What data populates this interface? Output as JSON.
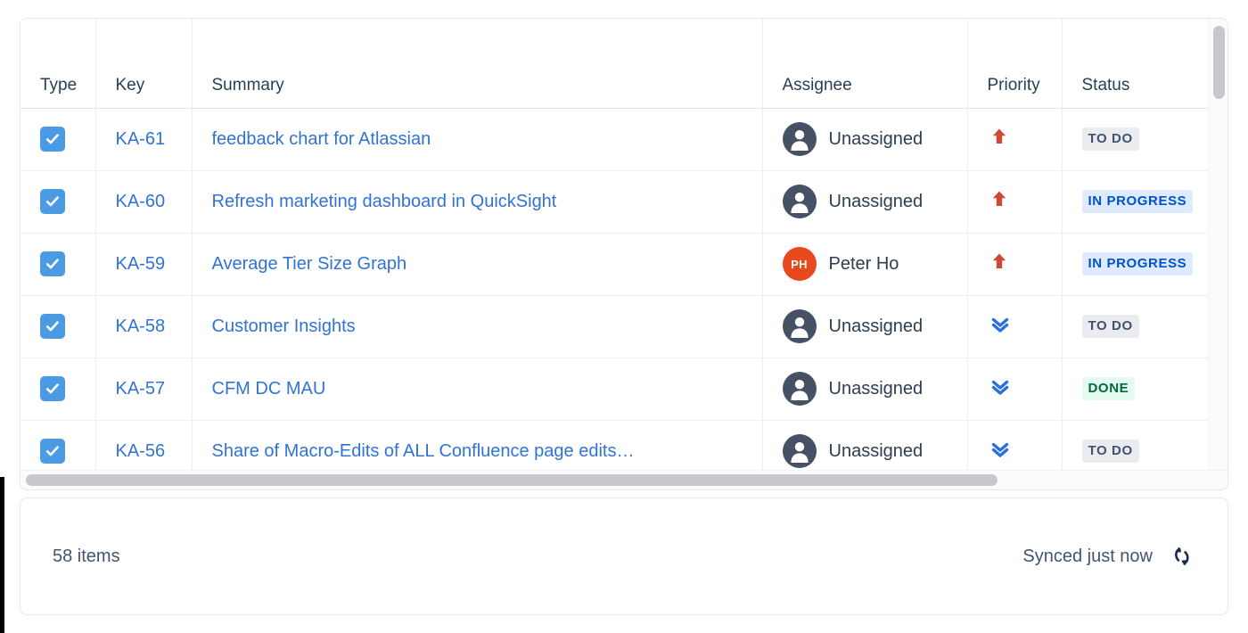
{
  "table": {
    "columns": [
      {
        "key": "type",
        "label": "Type"
      },
      {
        "key": "key",
        "label": "Key"
      },
      {
        "key": "summary",
        "label": "Summary"
      },
      {
        "key": "assignee",
        "label": "Assignee"
      },
      {
        "key": "priority",
        "label": "Priority"
      },
      {
        "key": "status",
        "label": "Status"
      }
    ],
    "rows": [
      {
        "type_icon": "task-checkbox-icon",
        "key": "KA-61",
        "summary": "feedback chart for Atlassian",
        "assignee": "Unassigned",
        "assignee_initials": "",
        "assignee_avatar": "unassigned-avatar-icon",
        "priority": "High",
        "priority_icon": "arrow-up-icon",
        "status": "TO DO",
        "status_kind": "todo"
      },
      {
        "type_icon": "task-checkbox-icon",
        "key": "KA-60",
        "summary": "Refresh marketing dashboard in QuickSight",
        "assignee": "Unassigned",
        "assignee_initials": "",
        "assignee_avatar": "unassigned-avatar-icon",
        "priority": "High",
        "priority_icon": "arrow-up-icon",
        "status": "IN PROGRESS",
        "status_kind": "inprogress"
      },
      {
        "type_icon": "task-checkbox-icon",
        "key": "KA-59",
        "summary": "Average Tier Size Graph",
        "assignee": "Peter Ho",
        "assignee_initials": "PH",
        "assignee_avatar": "user-initials-avatar",
        "priority": "High",
        "priority_icon": "arrow-up-icon",
        "status": "IN PROGRESS",
        "status_kind": "inprogress"
      },
      {
        "type_icon": "task-checkbox-icon",
        "key": "KA-58",
        "summary": "Customer Insights",
        "assignee": "Unassigned",
        "assignee_initials": "",
        "assignee_avatar": "unassigned-avatar-icon",
        "priority": "Low",
        "priority_icon": "double-chevron-down-icon",
        "status": "TO DO",
        "status_kind": "todo"
      },
      {
        "type_icon": "task-checkbox-icon",
        "key": "KA-57",
        "summary": "CFM DC MAU",
        "assignee": "Unassigned",
        "assignee_initials": "",
        "assignee_avatar": "unassigned-avatar-icon",
        "priority": "Low",
        "priority_icon": "double-chevron-down-icon",
        "status": "DONE",
        "status_kind": "done"
      },
      {
        "type_icon": "task-checkbox-icon",
        "key": "KA-56",
        "summary": "Share of Macro-Edits of ALL Confluence page edits…",
        "assignee": "Unassigned",
        "assignee_initials": "",
        "assignee_avatar": "unassigned-avatar-icon",
        "priority": "Low",
        "priority_icon": "double-chevron-down-icon",
        "status": "TO DO",
        "status_kind": "todo"
      }
    ]
  },
  "footer": {
    "items_count": "58 items",
    "sync_status": "Synced just now",
    "sync_icon": "refresh-sync-icon"
  },
  "colors": {
    "link_blue": "#3173d4",
    "type_icon_blue": "#4a9ae4",
    "priority_high_red": "#cd4a37",
    "priority_low_blue": "#2a6fdb",
    "avatar_unassigned": "#465166",
    "avatar_initials_bg": "#e8481c",
    "status_todo_bg": "#ebecf0",
    "status_todo_text": "#42526e",
    "status_inprogress_bg": "#deebff",
    "status_inprogress_text": "#0052cc",
    "status_done_bg": "#e3fcef",
    "status_done_text": "#006644",
    "card_border": "#e6e8ec",
    "scrollbar_thumb": "#c7c8cb"
  }
}
